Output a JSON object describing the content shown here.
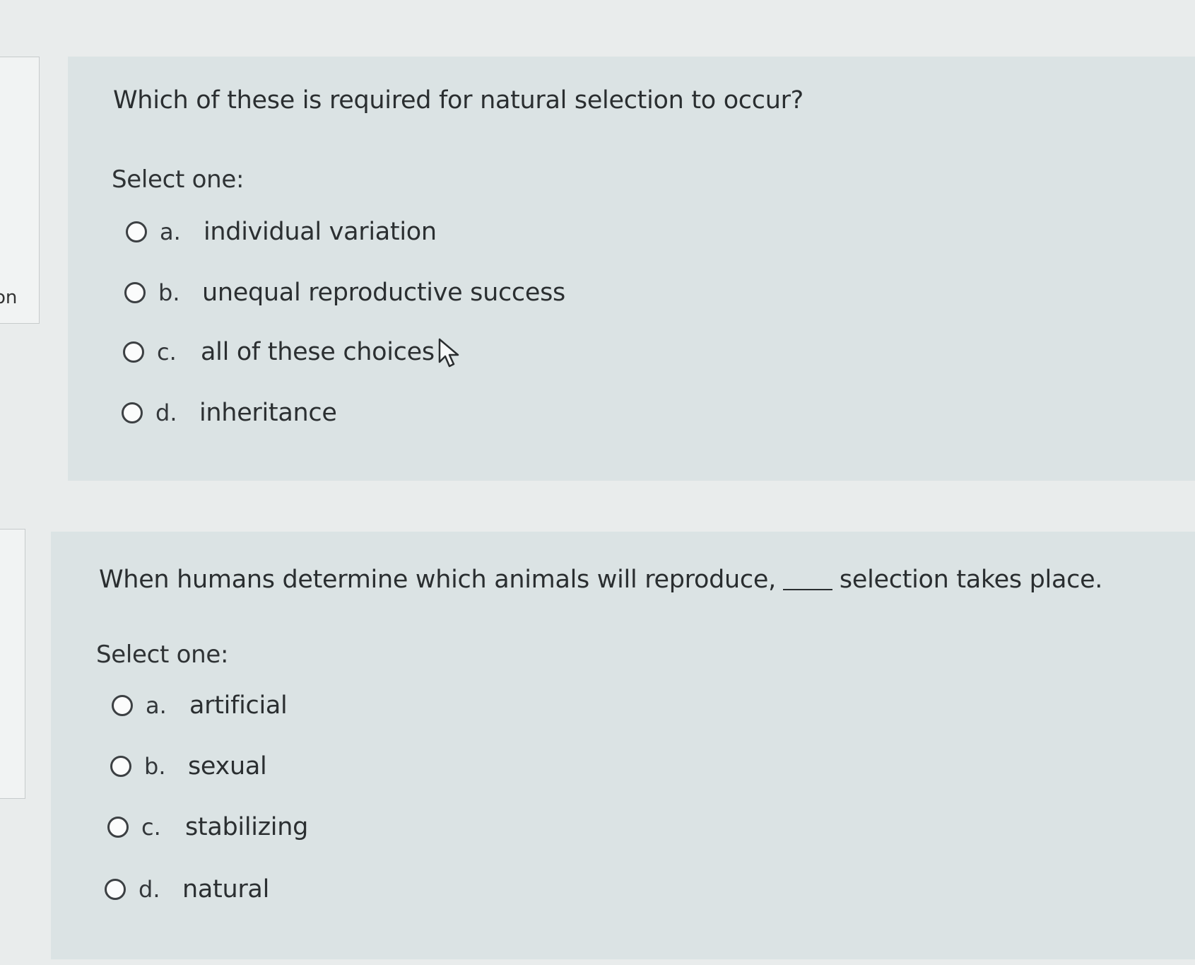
{
  "side_label": "on",
  "questions": [
    {
      "prompt": "Which of these is required for natural selection to occur?",
      "select_label": "Select one:",
      "options": [
        {
          "letter": "a.",
          "text": "individual variation"
        },
        {
          "letter": "b.",
          "text": "unequal reproductive success"
        },
        {
          "letter": "c.",
          "text": "all of these choices"
        },
        {
          "letter": "d.",
          "text": "inheritance"
        }
      ]
    },
    {
      "prompt_before": "When humans determine which animals will reproduce,",
      "prompt_after": "selection takes place.",
      "select_label": "Select one:",
      "options": [
        {
          "letter": "a.",
          "text": "artificial"
        },
        {
          "letter": "b.",
          "text": "sexual"
        },
        {
          "letter": "c.",
          "text": "stabilizing"
        },
        {
          "letter": "d.",
          "text": "natural"
        }
      ]
    }
  ],
  "icons": {
    "radio": "radio-unselected-icon",
    "cursor": "mouse-pointer-icon"
  }
}
